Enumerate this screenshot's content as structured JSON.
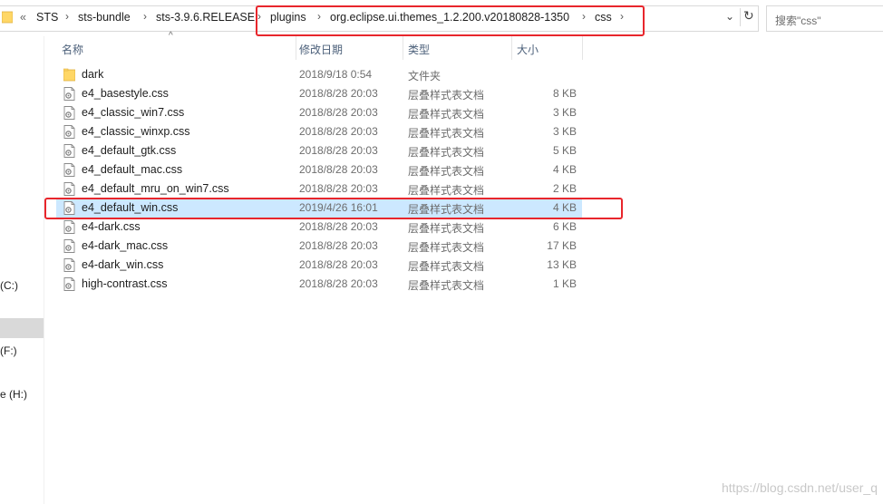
{
  "breadcrumb": {
    "overflow": "«",
    "items": [
      "STS",
      "sts-bundle",
      "sts-3.9.6.RELEASE",
      "plugins",
      "org.eclipse.ui.themes_1.2.200.v20180828-1350",
      "css"
    ]
  },
  "search": {
    "placeholder": "搜索\"css\""
  },
  "nav": {
    "items": [
      "(C:)",
      "(F:)",
      "e (H:)"
    ]
  },
  "columns": {
    "name": "名称",
    "date": "修改日期",
    "type": "类型",
    "size": "大小"
  },
  "files": [
    {
      "name": "dark",
      "date": "2018/9/18 0:54",
      "type": "文件夹",
      "size": "",
      "kind": "folder"
    },
    {
      "name": "e4_basestyle.css",
      "date": "2018/8/28 20:03",
      "type": "层叠样式表文档",
      "size": "8 KB",
      "kind": "css"
    },
    {
      "name": "e4_classic_win7.css",
      "date": "2018/8/28 20:03",
      "type": "层叠样式表文档",
      "size": "3 KB",
      "kind": "css"
    },
    {
      "name": "e4_classic_winxp.css",
      "date": "2018/8/28 20:03",
      "type": "层叠样式表文档",
      "size": "3 KB",
      "kind": "css"
    },
    {
      "name": "e4_default_gtk.css",
      "date": "2018/8/28 20:03",
      "type": "层叠样式表文档",
      "size": "5 KB",
      "kind": "css"
    },
    {
      "name": "e4_default_mac.css",
      "date": "2018/8/28 20:03",
      "type": "层叠样式表文档",
      "size": "4 KB",
      "kind": "css"
    },
    {
      "name": "e4_default_mru_on_win7.css",
      "date": "2018/8/28 20:03",
      "type": "层叠样式表文档",
      "size": "2 KB",
      "kind": "css"
    },
    {
      "name": "e4_default_win.css",
      "date": "2019/4/26 16:01",
      "type": "层叠样式表文档",
      "size": "4 KB",
      "kind": "css",
      "selected": true
    },
    {
      "name": "e4-dark.css",
      "date": "2018/8/28 20:03",
      "type": "层叠样式表文档",
      "size": "6 KB",
      "kind": "css"
    },
    {
      "name": "e4-dark_mac.css",
      "date": "2018/8/28 20:03",
      "type": "层叠样式表文档",
      "size": "17 KB",
      "kind": "css"
    },
    {
      "name": "e4-dark_win.css",
      "date": "2018/8/28 20:03",
      "type": "层叠样式表文档",
      "size": "13 KB",
      "kind": "css"
    },
    {
      "name": "high-contrast.css",
      "date": "2018/8/28 20:03",
      "type": "层叠样式表文档",
      "size": "1 KB",
      "kind": "css"
    }
  ],
  "watermark": "https://blog.csdn.net/user_q",
  "colors": {
    "selection": "#cce8ff",
    "annotation": "#e8262c",
    "folder": "#ffd766"
  }
}
